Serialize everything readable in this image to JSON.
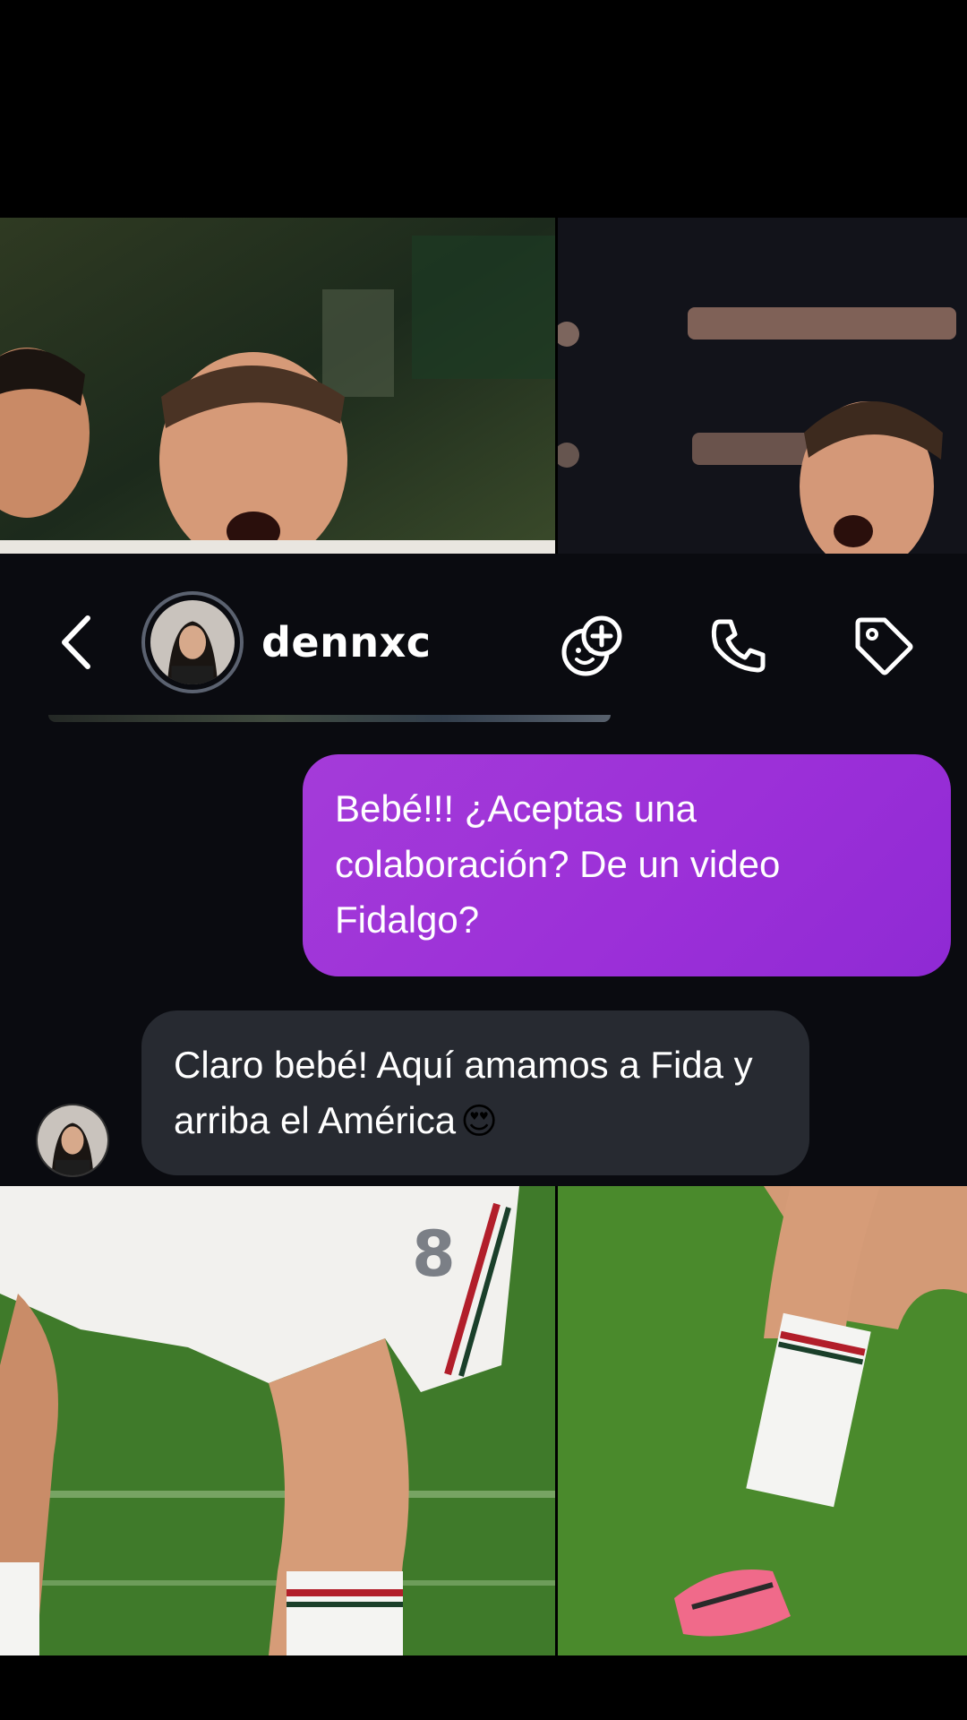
{
  "header": {
    "username": "dennxc",
    "icons": [
      "back-chevron-icon",
      "add-people-icon",
      "phone-icon",
      "tag-icon"
    ]
  },
  "messages": [
    {
      "sender": "me",
      "text": "Bebé!!! ¿Aceptas una colaboración? De un video Fidalgo?"
    },
    {
      "sender": "dennxc",
      "text": "Claro bebé! Aquí amamos a Fida y arriba el América",
      "emoji": "😍"
    }
  ],
  "colors": {
    "header_bg": "#0a0b10",
    "bubble_outgoing": "#9b2fd8",
    "bubble_incoming": "#272a31",
    "text": "#ffffff"
  }
}
